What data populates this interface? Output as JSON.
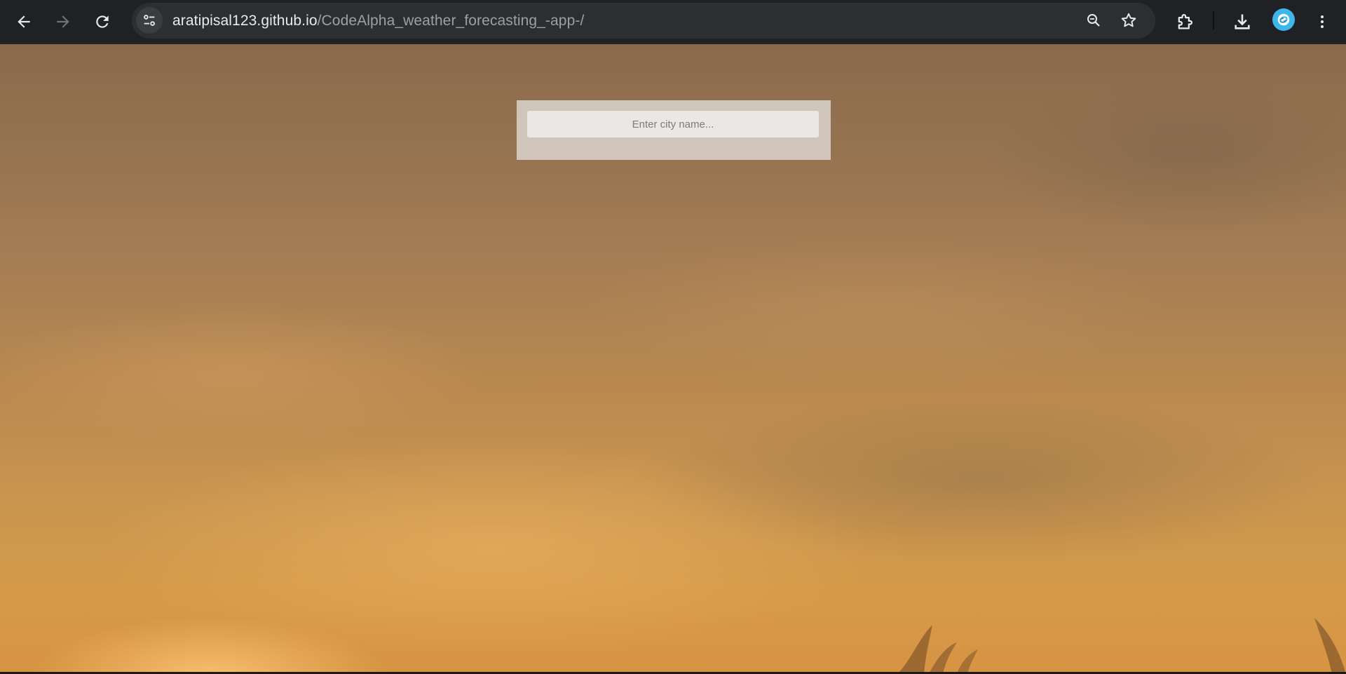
{
  "browser": {
    "url_host": "aratipisal123.github.io",
    "url_path": "/CodeAlpha_weather_forecasting_-app-/",
    "icons": {
      "back": "arrow-left-icon",
      "forward": "arrow-right-icon",
      "reload": "reload-icon",
      "site_info": "tune-icon",
      "zoom": "zoom-out-icon",
      "bookmark": "star-icon",
      "extensions": "puzzle-icon",
      "downloads": "download-icon",
      "profile": "avatar-icon",
      "menu": "kebab-menu-icon"
    },
    "colors": {
      "toolbar": "#202124",
      "omnibox": "#2d2e31",
      "avatar": "#3fb6ea"
    }
  },
  "app": {
    "search": {
      "placeholder": "Enter city name...",
      "value": ""
    },
    "colors": {
      "card": "#d6ccc4",
      "input": "#ebe7e4"
    }
  }
}
